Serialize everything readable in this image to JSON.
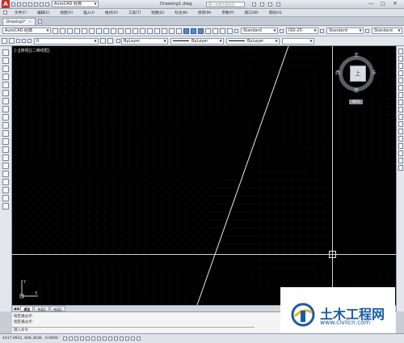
{
  "title_bar": {
    "workspace": "AutoCAD 经典",
    "file_title": "Drawing1.dwg",
    "search_placeholder": "键入关键字或短语",
    "controls": [
      "—",
      "□",
      "✕"
    ]
  },
  "menu": [
    "文件(F)",
    "编辑(E)",
    "视图(V)",
    "插入(I)",
    "格式(O)",
    "工具(T)",
    "绘图(D)",
    "标注(N)",
    "修改(M)",
    "参数(P)",
    "窗口(W)",
    "帮助(H)"
  ],
  "doc_tab": {
    "label": "Drawing1*",
    "close": "×"
  },
  "toolbar": {
    "workspace_combo": "AutoCAD 经典",
    "text_style": "Standard",
    "dim_style": "ISO-25",
    "table_style": "Standard",
    "multileader_style": "Standard"
  },
  "properties_bar": {
    "layer": "0",
    "color": "ByLayer",
    "linetype": "ByLayer",
    "lineweight": "ByLayer"
  },
  "viewport": {
    "label": "[-][俯视][二维线框]",
    "viewcube": {
      "face": "上",
      "north": "北",
      "south": "南",
      "east": "东",
      "west": "西",
      "wcs": "WCS"
    },
    "ucs_y": "Y",
    "ucs_x": "X"
  },
  "layout_tabs": [
    "模型",
    "布局1",
    "布局2"
  ],
  "command": {
    "history": [
      "指定通过点:",
      "指定通过点:"
    ],
    "prompt": "键入命令"
  },
  "status": {
    "coordinates": "4317.0931, 836.3030 , 0.0000"
  },
  "watermark": {
    "title": "土木工程网",
    "url": "www.civilcn.com"
  }
}
